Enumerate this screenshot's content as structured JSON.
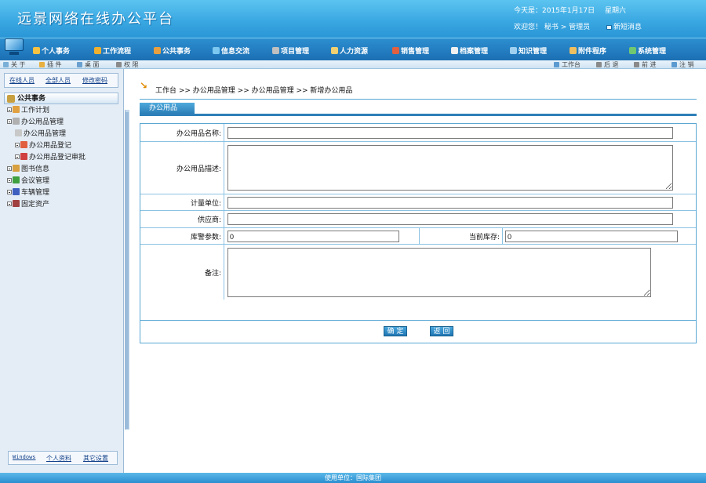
{
  "header": {
    "title": "远景网络在线办公平台",
    "date_prefix": "今天是：2015年1月17日",
    "weekday": "星期六",
    "welcome": "欢迎您！ 秘书 > 管理员",
    "new_message": "新短消息"
  },
  "menu": [
    {
      "label": "个人事务",
      "icon": "person-icon",
      "color": "#f5c242"
    },
    {
      "label": "工作流程",
      "icon": "workflow-icon",
      "color": "#f0b030"
    },
    {
      "label": "公共事务",
      "icon": "public-affairs-icon",
      "color": "#e8a040"
    },
    {
      "label": "信息交流",
      "icon": "chat-icon",
      "color": "#7cc8f0"
    },
    {
      "label": "项目管理",
      "icon": "project-icon",
      "color": "#c0c0c0"
    },
    {
      "label": "人力资源",
      "icon": "hr-icon",
      "color": "#f0d070"
    },
    {
      "label": "销售管理",
      "icon": "sales-icon",
      "color": "#e06040"
    },
    {
      "label": "档案管理",
      "icon": "archive-icon",
      "color": "#f0f0f0"
    },
    {
      "label": "知识管理",
      "icon": "knowledge-icon",
      "color": "#a0d0f0"
    },
    {
      "label": "附件程序",
      "icon": "attachment-icon",
      "color": "#f0c060"
    },
    {
      "label": "系统管理",
      "icon": "system-icon",
      "color": "#70c870"
    }
  ],
  "toolbar": {
    "left": [
      {
        "label": "关 于",
        "icon": "about-icon"
      },
      {
        "label": "插 件",
        "icon": "plugin-icon"
      },
      {
        "label": "桌 面",
        "icon": "desktop-icon"
      },
      {
        "label": "权 限",
        "icon": "permission-icon"
      }
    ],
    "right": [
      {
        "label": "工作台",
        "icon": "home-icon"
      },
      {
        "label": "后 退",
        "icon": "back-icon"
      },
      {
        "label": "前 进",
        "icon": "forward-icon"
      },
      {
        "label": "注 销",
        "icon": "logout-icon"
      }
    ]
  },
  "sidebar": {
    "top_links": [
      "在线人员",
      "全部人员",
      "修改密码"
    ],
    "tree_title": "公共事务",
    "tree": [
      {
        "label": "工作计划",
        "icon": "plan-icon",
        "color": "#e0a040"
      },
      {
        "label": "办公用品管理",
        "icon": "office-supplies-icon",
        "color": "#b0b0b0"
      },
      {
        "label": "办公用品管理",
        "icon": "supplies-manage-icon",
        "color": "#c8c8c8"
      },
      {
        "label": "办公用品登记",
        "icon": "supplies-register-icon",
        "color": "#e06040"
      },
      {
        "label": "办公用品登记审批",
        "icon": "supplies-approve-icon",
        "color": "#d04040"
      },
      {
        "label": "图书信息",
        "icon": "book-icon",
        "color": "#d8a040"
      },
      {
        "label": "会议管理",
        "icon": "meeting-icon",
        "color": "#40a040"
      },
      {
        "label": "车辆管理",
        "icon": "vehicle-icon",
        "color": "#4060c0"
      },
      {
        "label": "固定资产",
        "icon": "asset-icon",
        "color": "#a04040"
      }
    ],
    "bottom_links": [
      "Windows",
      "个人资料",
      "其它设置"
    ]
  },
  "content": {
    "breadcrumb": "工作台 >> 办公用品管理 >> 办公用品管理 >> 新增办公用品",
    "tab": "办公用品",
    "form": {
      "name_label": "办公用品名称:",
      "name_value": "",
      "desc_label": "办公用品描述:",
      "desc_value": "",
      "unit_label": "计量单位:",
      "unit_value": "",
      "supplier_label": "供应商:",
      "supplier_value": "",
      "stock_param_label": "库警参数:",
      "stock_param_value": "0",
      "current_stock_label": "当前库存:",
      "current_stock_value": "0",
      "remark_label": "备注:",
      "remark_value": ""
    },
    "buttons": {
      "confirm": "确 定",
      "back": "返 回"
    }
  },
  "footer": {
    "text": "使用单位：国际集团"
  }
}
